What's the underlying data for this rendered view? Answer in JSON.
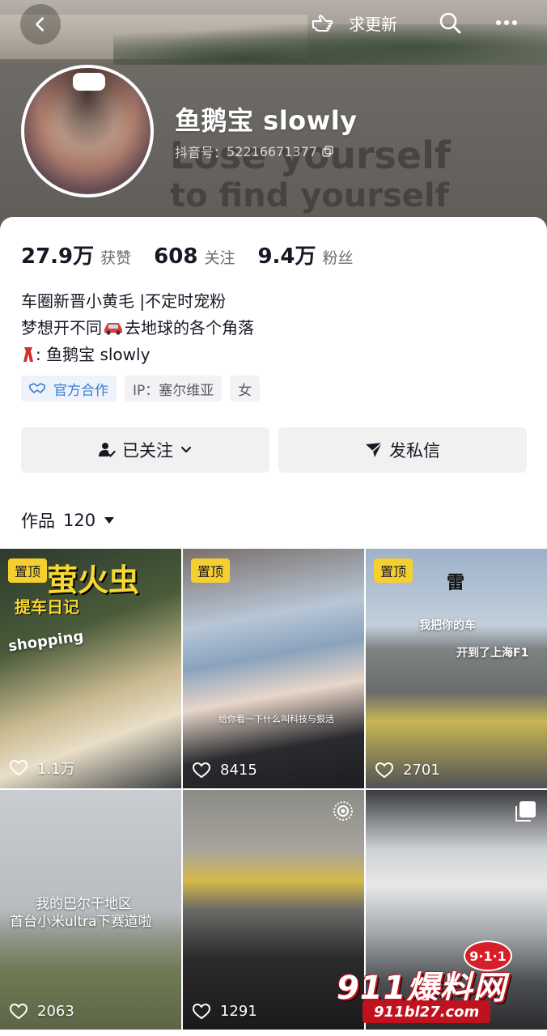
{
  "header": {
    "request_update_label": "求更新",
    "banner_slogan_line1": "Lose yourself",
    "banner_slogan_line2": "to find yourself"
  },
  "profile": {
    "name": "鱼鹅宝 slowly",
    "douyin_id_label": "抖音号：",
    "douyin_id": "52216671377"
  },
  "stats": [
    {
      "value": "27.9万",
      "label": "获赞"
    },
    {
      "value": "608",
      "label": "关注"
    },
    {
      "value": "9.4万",
      "label": "粉丝"
    }
  ],
  "bio": {
    "line1": "车圈新晋小黄毛 |不定时宠粉",
    "line2_before": "梦想开不同",
    "line2_after": "去地球的各个角落",
    "line3": ": 鱼鹅宝 slowly"
  },
  "tags": {
    "official": "官方合作",
    "ip": "IP：塞尔维亚",
    "gender": "女"
  },
  "actions": {
    "followed": "已关注",
    "message": "发私信"
  },
  "works": {
    "label": "作品",
    "count": "120"
  },
  "grid": [
    {
      "pinned": "置顶",
      "likes": "1.1万",
      "title": "萤火虫",
      "subtitle": "提车日记",
      "caption": "shopping"
    },
    {
      "pinned": "置顶",
      "likes": "8415",
      "caption": "给你看一下什么叫科技与狠活"
    },
    {
      "pinned": "置顶",
      "likes": "2701",
      "caption1": "雷",
      "caption2": "我把你的车",
      "caption3": "开到了上海F1"
    },
    {
      "likes": "2063",
      "caption1": "我的巴尔干地区",
      "caption2": "首台小米ultra下赛道啦"
    },
    {
      "likes": "1291"
    },
    {
      "likes": ""
    }
  ],
  "watermark": {
    "brand": "911爆料网",
    "badge": "9·1·1",
    "url": "911bl27.com"
  }
}
